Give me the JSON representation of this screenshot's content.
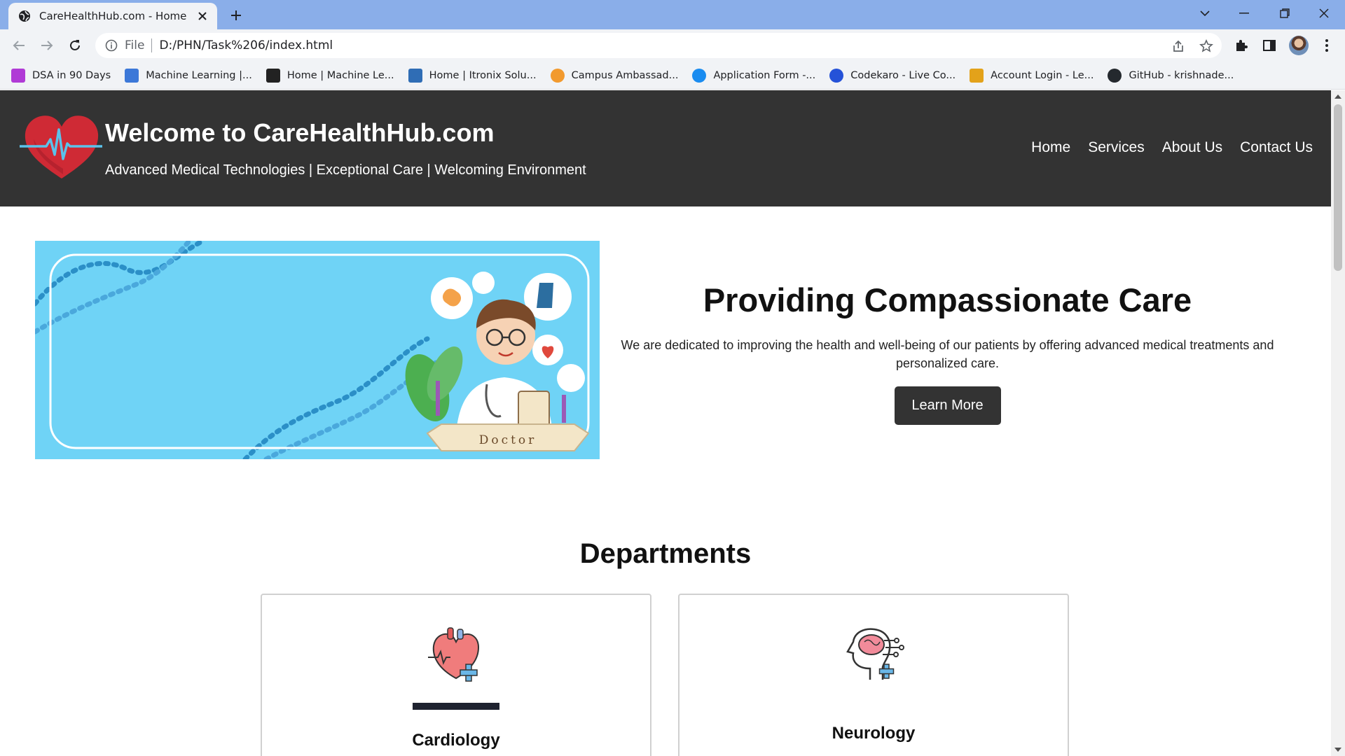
{
  "browser": {
    "tab_title": "CareHealthHub.com - Home",
    "url_scheme": "File",
    "url": "D:/PHN/Task%206/index.html",
    "bookmarks": [
      {
        "label": "DSA in 90 Days",
        "icon": "dsa-icon",
        "color": "#b03ad6"
      },
      {
        "label": "Machine Learning |...",
        "icon": "code-brackets-icon",
        "color": "#3c78d8"
      },
      {
        "label": "Home | Machine Le...",
        "icon": "aml-icon",
        "color": "#222222"
      },
      {
        "label": "Home | Itronix Solu...",
        "icon": "itronix-icon",
        "color": "#2f6db5"
      },
      {
        "label": "Campus Ambassad...",
        "icon": "campus-icon",
        "color": "#f29a2e"
      },
      {
        "label": "Application Form -...",
        "icon": "skype-icon",
        "color": "#1a8cf0"
      },
      {
        "label": "Codekaro - Live Co...",
        "icon": "codekaro-icon",
        "color": "#2552d8"
      },
      {
        "label": "Account Login - Le...",
        "icon": "leetcode-icon",
        "color": "#e3a21a"
      },
      {
        "label": "GitHub - krishnade...",
        "icon": "github-icon",
        "color": "#24292e"
      }
    ]
  },
  "site": {
    "title": "Welcome to CareHealthHub.com",
    "tagline": "Advanced Medical Technologies | Exceptional Care | Welcoming Environment",
    "nav": [
      "Home",
      "Services",
      "About Us",
      "Contact Us"
    ]
  },
  "hero": {
    "heading": "Providing Compassionate Care",
    "description": "We are dedicated to improving the health and well-being of our patients by offering advanced medical treatments and personalized care.",
    "button": "Learn More",
    "image_caption": "Doctor"
  },
  "departments": {
    "heading": "Departments",
    "items": [
      {
        "name": "Cardiology",
        "icon": "heart-organ-icon"
      },
      {
        "name": "Neurology",
        "icon": "brain-head-icon"
      }
    ]
  },
  "colors": {
    "header_bg": "#333333",
    "button_bg": "#333333",
    "hero_bg": "#6fd3f6",
    "tabstrip": "#8aaee9"
  }
}
